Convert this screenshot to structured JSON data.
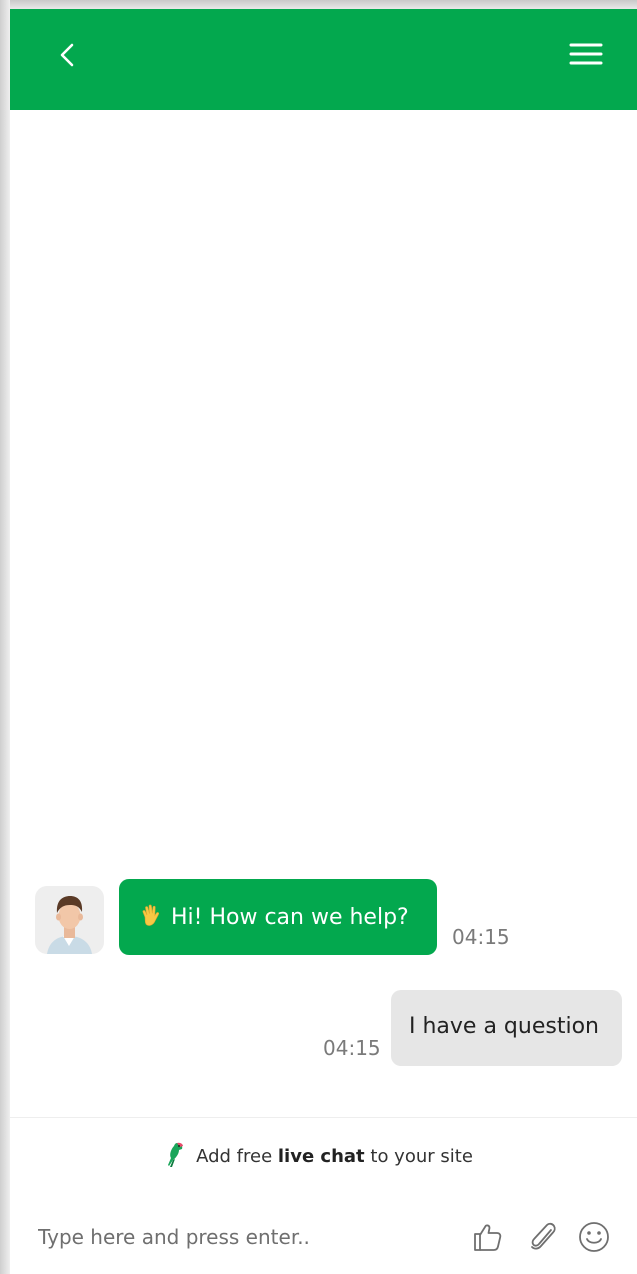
{
  "header": {
    "back_icon": "chevron-left-icon",
    "menu_icon": "hamburger-menu-icon",
    "background": "#03a84e"
  },
  "messages": [
    {
      "direction": "incoming",
      "emoji_icon": "waving-hand-icon",
      "text": "Hi! How can we help?",
      "time": "04:15",
      "bubble_color": "#03a84e"
    },
    {
      "direction": "outgoing",
      "text": "I have a question",
      "time": "04:15",
      "bubble_color": "#e6e6e6"
    }
  ],
  "branding": {
    "icon": "parrot-icon",
    "prefix": "Add free ",
    "bold": "live chat",
    "suffix": " to your site"
  },
  "composer": {
    "placeholder": "Type here and press enter..",
    "value": "",
    "tools": [
      "thumbs-up-icon",
      "paperclip-icon",
      "smiley-icon"
    ]
  }
}
